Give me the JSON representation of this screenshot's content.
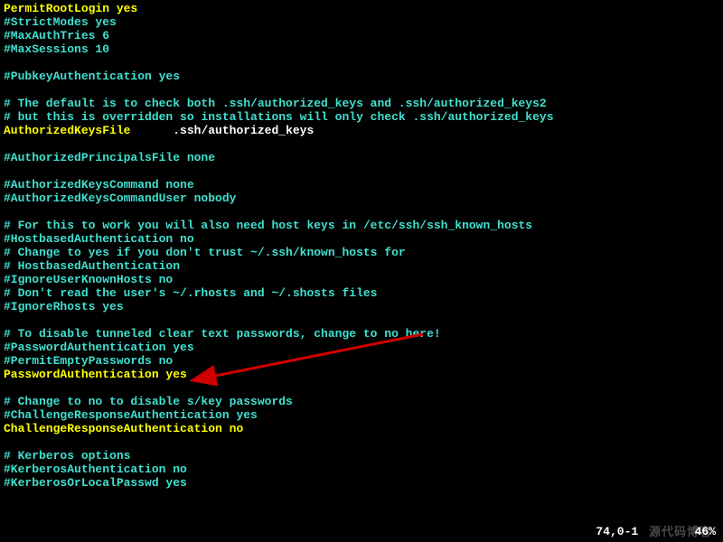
{
  "lines": [
    [
      {
        "c": "yellow",
        "t": "PermitRootLogin yes"
      }
    ],
    [
      {
        "c": "teal",
        "t": "#StrictModes yes"
      }
    ],
    [
      {
        "c": "teal",
        "t": "#MaxAuthTries 6"
      }
    ],
    [
      {
        "c": "teal",
        "t": "#MaxSessions 10"
      }
    ],
    [
      {
        "c": "teal",
        "t": ""
      }
    ],
    [
      {
        "c": "teal",
        "t": "#PubkeyAuthentication yes"
      }
    ],
    [
      {
        "c": "teal",
        "t": ""
      }
    ],
    [
      {
        "c": "teal",
        "t": "# The default is to check both .ssh/authorized_keys and .ssh/authorized_keys2"
      }
    ],
    [
      {
        "c": "teal",
        "t": "# but this is overridden so installations will only check .ssh/authorized_keys"
      }
    ],
    [
      {
        "c": "yellow",
        "t": "AuthorizedKeysFile"
      },
      {
        "c": "white",
        "t": "      .ssh/authorized_keys"
      }
    ],
    [
      {
        "c": "teal",
        "t": ""
      }
    ],
    [
      {
        "c": "teal",
        "t": "#AuthorizedPrincipalsFile none"
      }
    ],
    [
      {
        "c": "teal",
        "t": ""
      }
    ],
    [
      {
        "c": "teal",
        "t": "#AuthorizedKeysCommand none"
      }
    ],
    [
      {
        "c": "teal",
        "t": "#AuthorizedKeysCommandUser nobody"
      }
    ],
    [
      {
        "c": "teal",
        "t": ""
      }
    ],
    [
      {
        "c": "teal",
        "t": "# For this to work you will also need host keys in /etc/ssh/ssh_known_hosts"
      }
    ],
    [
      {
        "c": "teal",
        "t": "#HostbasedAuthentication no"
      }
    ],
    [
      {
        "c": "teal",
        "t": "# Change to yes if you don't trust ~/.ssh/known_hosts for"
      }
    ],
    [
      {
        "c": "teal",
        "t": "# HostbasedAuthentication"
      }
    ],
    [
      {
        "c": "teal",
        "t": "#IgnoreUserKnownHosts no"
      }
    ],
    [
      {
        "c": "teal",
        "t": "# Don't read the user's ~/.rhosts and ~/.shosts files"
      }
    ],
    [
      {
        "c": "teal",
        "t": "#IgnoreRhosts yes"
      }
    ],
    [
      {
        "c": "teal",
        "t": ""
      }
    ],
    [
      {
        "c": "teal",
        "t": "# To disable tunneled clear text passwords, change to no here!"
      }
    ],
    [
      {
        "c": "teal",
        "t": "#PasswordAuthentication yes"
      }
    ],
    [
      {
        "c": "teal",
        "t": "#PermitEmptyPasswords no"
      }
    ],
    [
      {
        "c": "yellow",
        "t": "PasswordAuthentication yes"
      }
    ],
    [
      {
        "c": "teal",
        "t": ""
      }
    ],
    [
      {
        "c": "teal",
        "t": "# Change to no to disable s/key passwords"
      }
    ],
    [
      {
        "c": "teal",
        "t": "#ChallengeResponseAuthentication yes"
      }
    ],
    [
      {
        "c": "yellow",
        "t": "ChallengeResponseAuthentication no"
      }
    ],
    [
      {
        "c": "teal",
        "t": ""
      }
    ],
    [
      {
        "c": "teal",
        "t": "# Kerberos options"
      }
    ],
    [
      {
        "c": "teal",
        "t": "#KerberosAuthentication no"
      }
    ],
    [
      {
        "c": "teal",
        "t": "#KerberosOrLocalPasswd yes"
      }
    ]
  ],
  "status": {
    "position": "74,0-1",
    "percent": "46%"
  },
  "watermark": "源代码博客"
}
